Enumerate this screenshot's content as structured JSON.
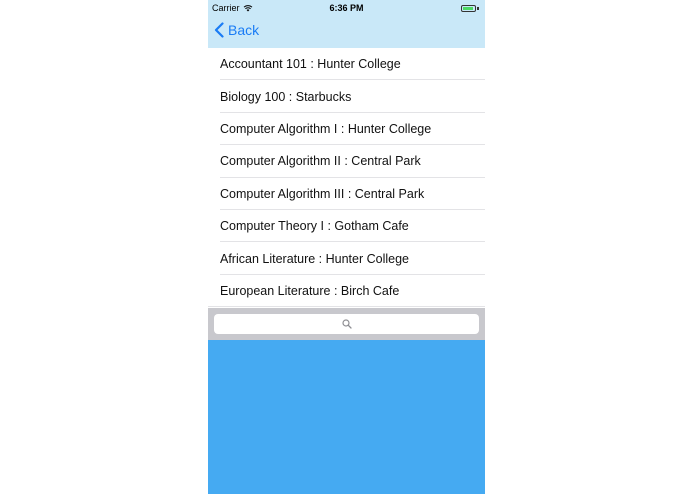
{
  "status_bar": {
    "carrier": "Carrier",
    "time": "6:36 PM",
    "battery_level": 0.9
  },
  "nav_bar": {
    "back_label": "Back"
  },
  "list": {
    "items": [
      {
        "label": "Accountant 101 : Hunter College"
      },
      {
        "label": "Biology 100 : Starbucks"
      },
      {
        "label": "Computer Algorithm I : Hunter College"
      },
      {
        "label": "Computer Algorithm II : Central Park"
      },
      {
        "label": "Computer Algorithm III : Central Park"
      },
      {
        "label": "Computer Theory I : Gotham Cafe"
      },
      {
        "label": "African Literature : Hunter College"
      },
      {
        "label": "European Literature : Birch Cafe"
      }
    ]
  },
  "search": {
    "value": "",
    "placeholder": "",
    "icon": "search-icon"
  },
  "colors": {
    "nav_background": "#c9e8f8",
    "accent": "#1a7cf5",
    "search_bar_background": "#c8c8cd",
    "blue_area": "#45aaf2",
    "battery_fill": "#4cd964"
  }
}
